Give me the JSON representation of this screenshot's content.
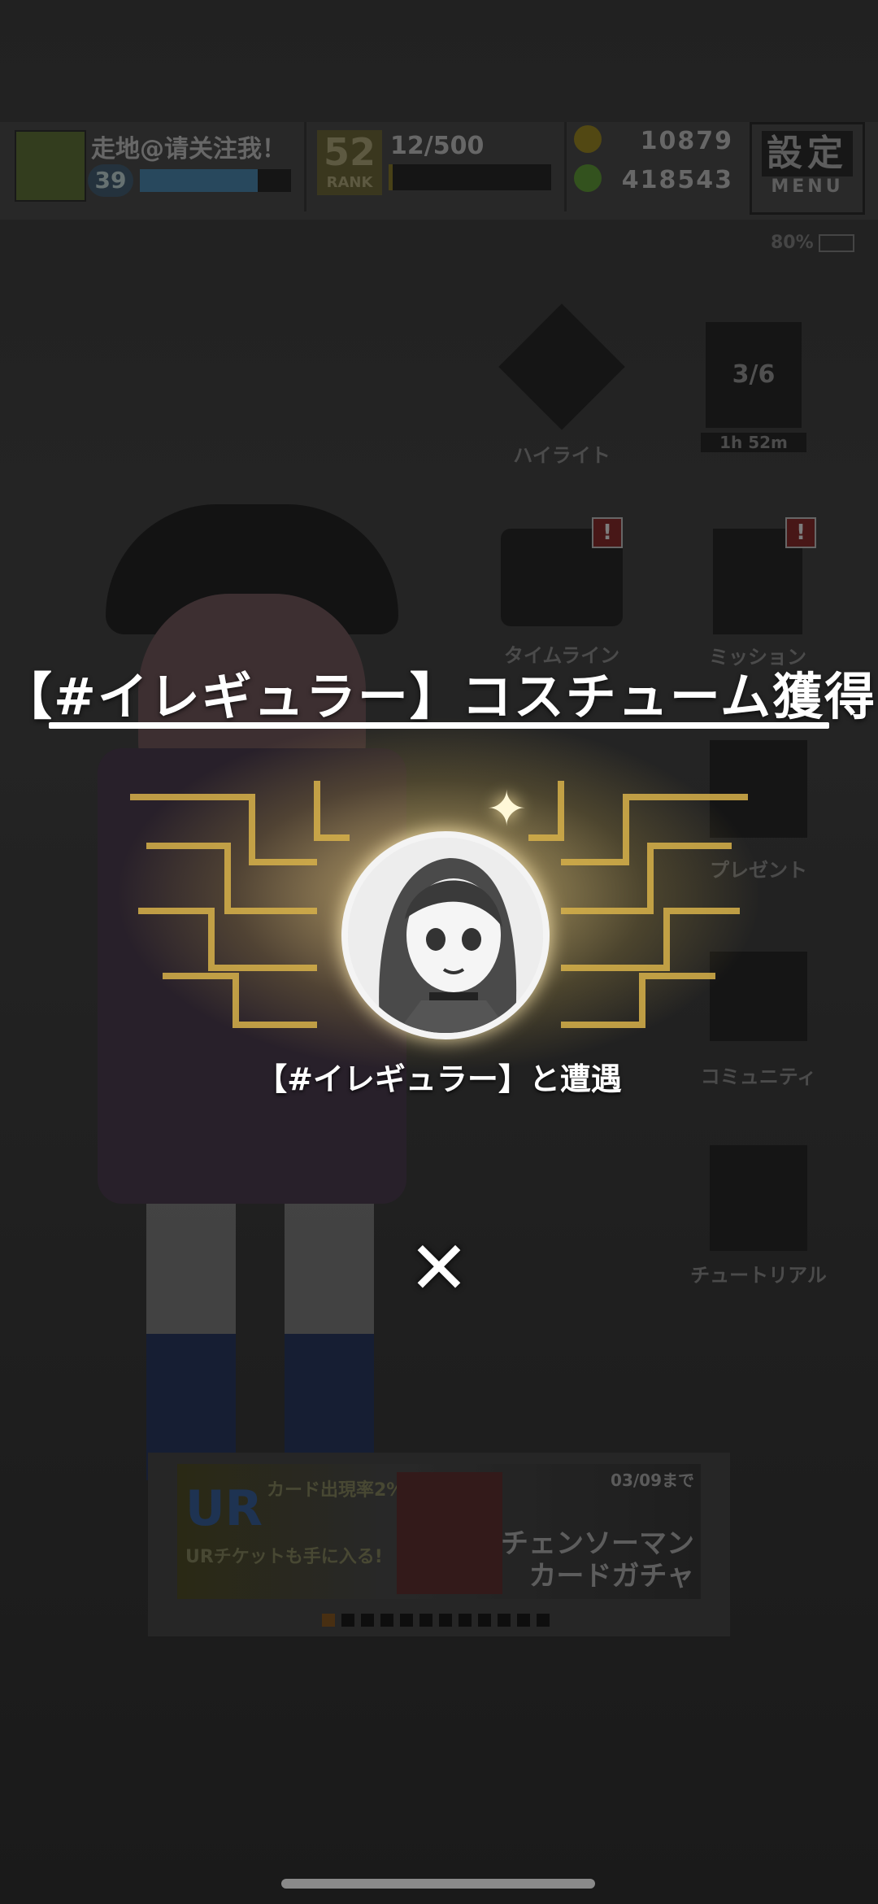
{
  "hud": {
    "username": "走地@请关注我！",
    "level": "39",
    "exp_progress": 0.78,
    "rank": "52",
    "rank_label": "RANK",
    "rank_count": "12/500",
    "rank_progress": 0.024,
    "currency_b": "10879",
    "currency_e": "418543",
    "settings_label": "設定",
    "menu_label": "MENU",
    "battery": "80%"
  },
  "side_menu": {
    "highlight": "ハイライト",
    "season_progress": "3/6",
    "timer": "1h 52m",
    "timeline": "タイムライン",
    "mission": "ミッション",
    "present": "プレゼント",
    "community": "コミュニティ",
    "tutorial": "チュートリアル"
  },
  "banner": {
    "ur": "UR",
    "rate_text": "カード出現率2%!",
    "ticket_text": "URチケットも手に入る!",
    "date": "03/09まで",
    "title_line1": "チェンソーマン",
    "title_line2": "カードガチャ",
    "page_count": 12,
    "active_page": 1
  },
  "modal": {
    "title": "【#イレギュラー】コスチューム獲得",
    "caption": "【#イレギュラー】と遭遇",
    "close_symbol": "✕"
  },
  "colors": {
    "modal_text": "#ffffff",
    "glow": "#ffe9a8",
    "alert": "#6a1f1f"
  }
}
